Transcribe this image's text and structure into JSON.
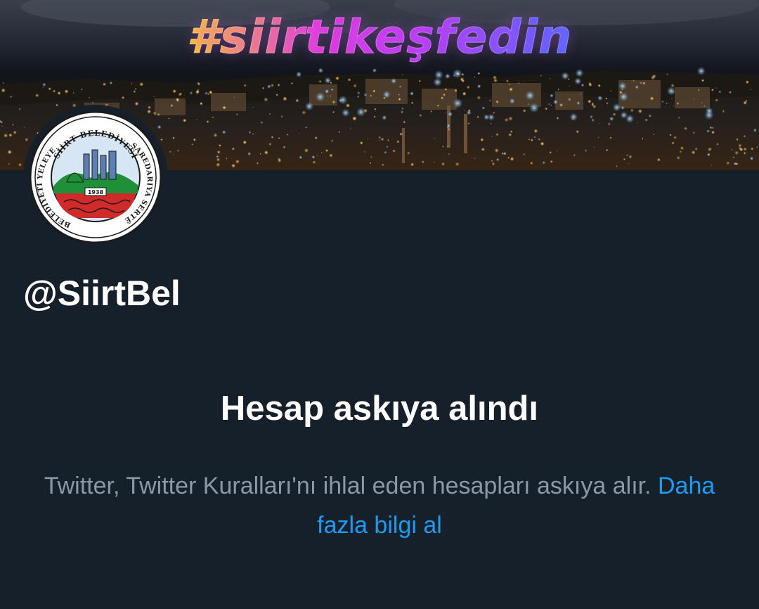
{
  "banner": {
    "hashtag": "#siirtikeşfedin"
  },
  "avatar": {
    "icon": "municipality-seal-icon",
    "seal_text_top": "SİİRT BELEDİYESİ",
    "seal_text_right": "SAREDARIYA SERTÊ",
    "seal_text_left": "BELEDİYETİ YELEYE",
    "seal_year": "1938"
  },
  "profile": {
    "handle": "@SiirtBel"
  },
  "suspension": {
    "title": "Hesap askıya alındı",
    "description": "Twitter, Twitter Kuralları'nı ihlal eden hesapları askıya alır.",
    "link_label": "Daha fazla bilgi al"
  },
  "colors": {
    "background": "#15202b",
    "text_primary": "#ffffff",
    "text_secondary": "#8b98a5",
    "link": "#1d9bf0"
  }
}
